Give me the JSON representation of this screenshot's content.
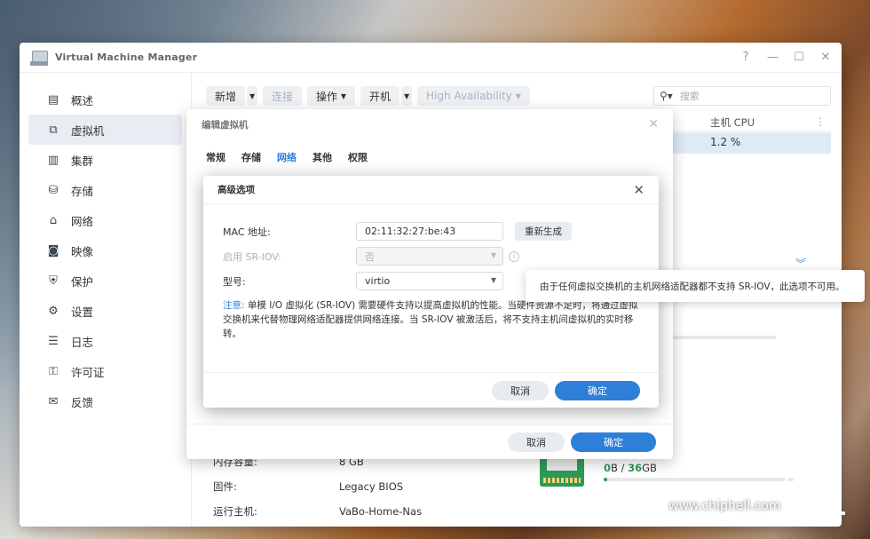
{
  "window": {
    "title": "Virtual Machine Manager",
    "controls": [
      "?",
      "—",
      "☐",
      "✕"
    ]
  },
  "sidebar": {
    "items": [
      {
        "label": "概述",
        "icon": "overview-icon",
        "active": false
      },
      {
        "label": "虚拟机",
        "icon": "vm-icon",
        "active": true
      },
      {
        "label": "集群",
        "icon": "cluster-icon",
        "active": false
      },
      {
        "label": "存储",
        "icon": "storage-icon",
        "active": false
      },
      {
        "label": "网络",
        "icon": "network-icon",
        "active": false
      },
      {
        "label": "映像",
        "icon": "image-icon",
        "active": false
      },
      {
        "label": "保护",
        "icon": "shield-icon",
        "active": false
      },
      {
        "label": "设置",
        "icon": "gear-icon",
        "active": false
      },
      {
        "label": "日志",
        "icon": "log-icon",
        "active": false
      },
      {
        "label": "许可证",
        "icon": "key-icon",
        "active": false
      },
      {
        "label": "反馈",
        "icon": "feedback-icon",
        "active": false
      }
    ]
  },
  "toolbar": {
    "create": "新增",
    "connect": "连接",
    "action": "操作",
    "power_on": "开机",
    "ha": "High Availability",
    "search_placeholder": "搜索"
  },
  "table": {
    "header_cpu": "主机 CPU",
    "row_cpu": "1.2 %"
  },
  "details": {
    "rows": [
      {
        "key": "内存容量:",
        "value": "8 GB"
      },
      {
        "key": "固件:",
        "value": "Legacy BIOS"
      },
      {
        "key": "运行主机:",
        "value": "VaBo-Home-Nas"
      }
    ],
    "mem_used": "0",
    "mem_used_unit": "B",
    "mem_sep": " / ",
    "mem_total": "36",
    "mem_total_unit": "GB"
  },
  "edit_dialog": {
    "title": "编辑虚拟机",
    "tabs": [
      "常规",
      "存储",
      "网络",
      "其他",
      "权限"
    ],
    "active_tab": "网络",
    "cancel": "取消",
    "ok": "确定"
  },
  "advanced_dialog": {
    "title": "高级选项",
    "mac_label": "MAC 地址:",
    "mac_value": "02:11:32:27:be:43",
    "regen": "重新生成",
    "sriov_label": "启用 SR-IOV:",
    "sriov_value": "否",
    "model_label": "型号:",
    "model_value": "virtio",
    "note_label": "注意:",
    "note_text": "单模 I/O 虚拟化 (SR-IOV) 需要硬件支持以提高虚拟机的性能。当硬件资源不足时，将通过虚拟交换机来代替物理网络适配器提供网络连接。当 SR-IOV 被激活后，将不支持主机间虚拟机的实时移转。",
    "cancel": "取消",
    "ok": "确定"
  },
  "tooltip": {
    "text": "由于任何虚拟交换机的主机网络适配器都不支持 SR-IOV，此选项不可用。"
  },
  "watermark": {
    "url": "www.chiphell.com",
    "logo_text": "chip hell"
  },
  "colors": {
    "accent": "#2e7fd8",
    "memory_green": "#2f9a57",
    "row_selected": "#dfeaf5"
  }
}
